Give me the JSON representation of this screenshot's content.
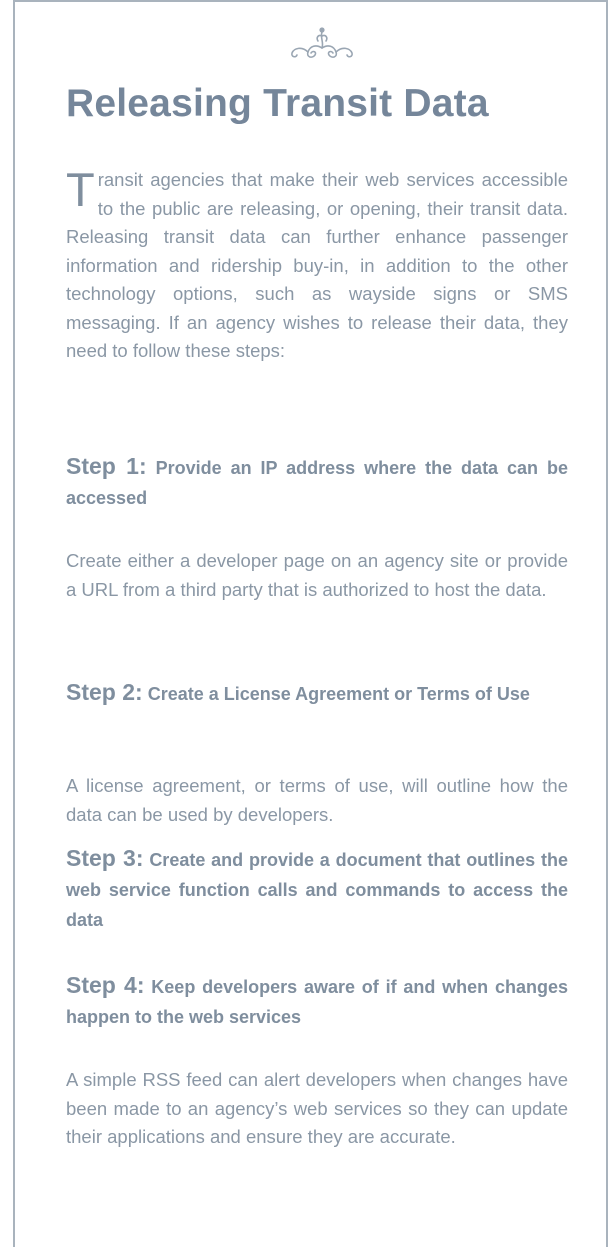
{
  "title": "Releasing Transit Data",
  "intro": {
    "dropcap": "T",
    "text": "ransit agencies that make their web services accessible to the public are releasing, or opening, their transit data. Releasing transit data can further enhance passenger information and ridership buy-in, in addition to the other technology options, such as wayside signs or SMS messaging. If an agency wishes to release their data, they need to follow these steps:"
  },
  "steps": [
    {
      "label": "Step 1:",
      "heading": "Provide an IP address where the data can be accessed",
      "text": "Create either a developer page on an agency site or provide a URL from a third party that is authorized to host the data."
    },
    {
      "label": "Step 2:",
      "heading": "Create a License Agreement or Terms of Use",
      "text": "A license agreement, or terms of use, will outline how the data can be used by developers."
    },
    {
      "label": "Step 3:",
      "heading": "Create and provide a document that outlines the web service function calls and commands to access the data",
      "text": ""
    },
    {
      "label": "Step 4:",
      "heading": "Keep developers aware of if and when changes happen to the web services",
      "text": "A simple RSS feed can alert developers when changes have been made to an agency’s web services so they can update their applications and ensure they are accurate."
    }
  ],
  "colors": {
    "title": "#75869a",
    "body_text": "#8a97a5",
    "border": "#a9b3bd"
  },
  "icons": {
    "ornament": "flourish-ornament-icon"
  }
}
